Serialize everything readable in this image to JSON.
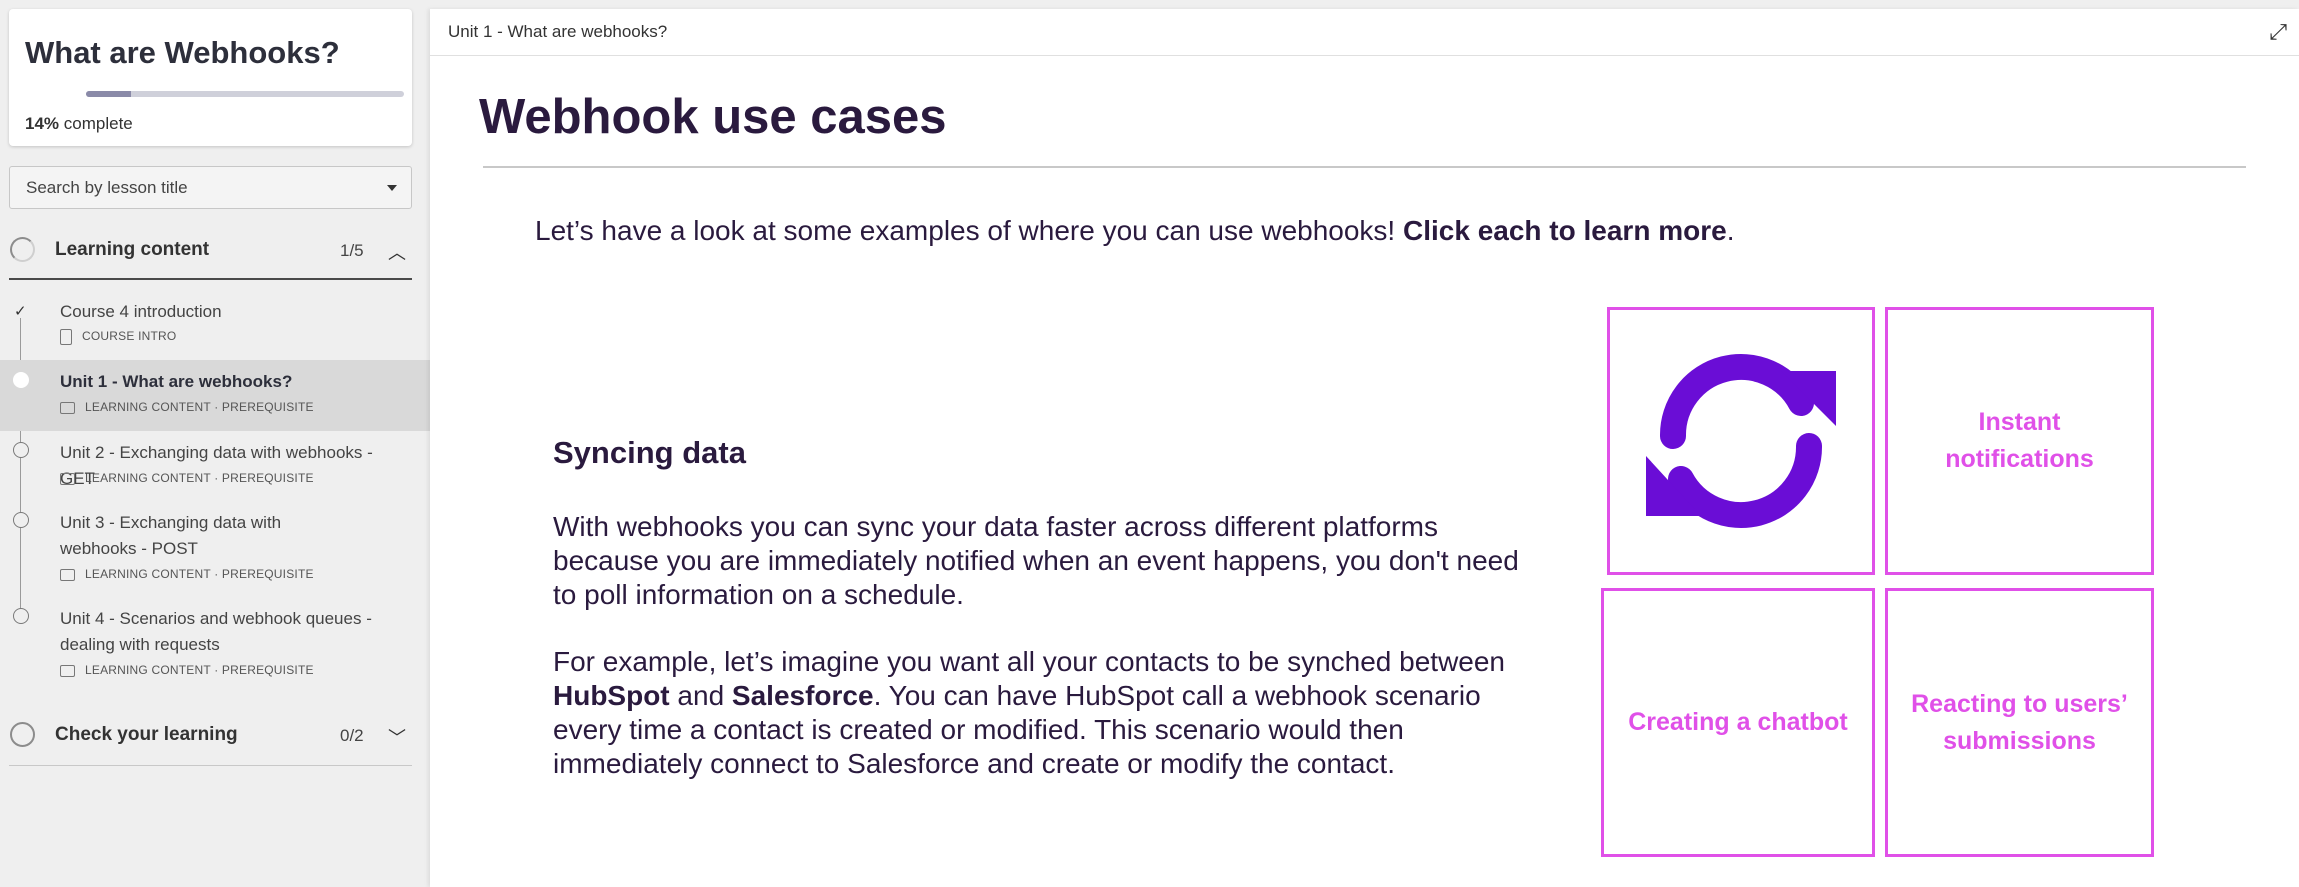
{
  "sidebar": {
    "course_title": "What are Webhooks?",
    "progress_percent": "14%",
    "progress_label": "complete",
    "progress_fraction": 0.14,
    "search_placeholder": "Search by lesson title",
    "sections": [
      {
        "label": "Learning content",
        "count": "1/5",
        "expanded": true
      },
      {
        "label": "Check your learning",
        "count": "0/2",
        "expanded": false
      }
    ],
    "lessons": [
      {
        "title": "Course 4 introduction",
        "meta": "COURSE INTRO",
        "status": "completed"
      },
      {
        "title": "Unit 1 - What are webhooks?",
        "meta": "LEARNING CONTENT · PREREQUISITE",
        "status": "current"
      },
      {
        "title": "Unit 2 - Exchanging data with webhooks - GET",
        "meta": "LEARNING CONTENT · PREREQUISITE",
        "status": "not-started"
      },
      {
        "title": "Unit 3 - Exchanging data with webhooks - POST",
        "meta": "LEARNING CONTENT · PREREQUISITE",
        "status": "not-started"
      },
      {
        "title": "Unit 4 - Scenarios and webhook queues - dealing with requests",
        "meta": "LEARNING CONTENT · PREREQUISITE",
        "status": "not-started"
      }
    ]
  },
  "main": {
    "breadcrumb": "Unit 1 - What are webhooks?",
    "heading": "Webhook use cases",
    "intro_text": "Let’s have a look at some examples of where you can use webhooks! ",
    "intro_bold": "Click each to learn more",
    "intro_end": ".",
    "panel": {
      "title": "Syncing data",
      "para1": "With webhooks you can sync your data faster across different platforms because you are immediately notified when an event happens, you don't need to poll information on a schedule.",
      "para2_a": "For example, let’s imagine you want all your contacts to be synched between ",
      "para2_b1": "HubSpot",
      "para2_c": " and ",
      "para2_b2": "Salesforce",
      "para2_d": ". You can have HubSpot call a webhook scenario every time a contact is created or modified. This scenario would then immediately connect to Salesforce and create or modify the contact."
    },
    "tiles": [
      {
        "label": "",
        "icon": "sync-icon"
      },
      {
        "label": "Instant notifications"
      },
      {
        "label": "Creating a chatbot"
      },
      {
        "label": "Reacting to users’ submissions"
      }
    ]
  },
  "colors": {
    "accent": "#e050e8",
    "sync_icon": "#6a0dd6",
    "text": "#2a1a3e"
  }
}
